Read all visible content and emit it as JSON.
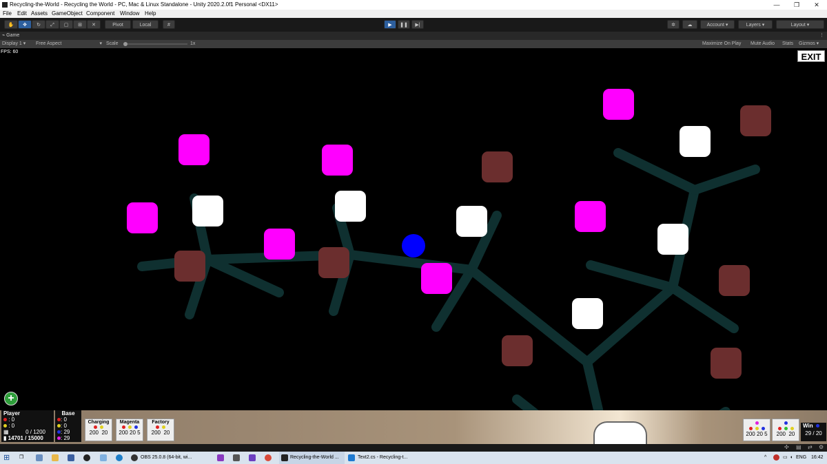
{
  "window": {
    "title": "Recycling-the-World - Recycling the World - PC, Mac & Linux Standalone - Unity 2020.2.0f1 Personal <DX11>",
    "minimize": "—",
    "maximize": "❐",
    "close": "✕"
  },
  "menu": [
    "File",
    "Edit",
    "Assets",
    "GameObject",
    "Component",
    "Window",
    "Help"
  ],
  "toolbar": {
    "pivot": "Pivot",
    "local": "Local",
    "account": "Account",
    "layers": "Layers",
    "layout": "Layout"
  },
  "game_tab": {
    "label": "Game"
  },
  "game_bar": {
    "display": "Display 1",
    "aspect": "Free Aspect",
    "scale_label": "Scale",
    "scale_value": "1x",
    "maximize": "Maximize On Play",
    "mute": "Mute Audio",
    "stats": "Stats",
    "gizmos": "Gizmos"
  },
  "game": {
    "fps": "FPS: 60",
    "exit": "EXIT",
    "colors": {
      "magenta": "#ff00ff",
      "brown": "#6b2e2e",
      "white": "#ffffff",
      "blue": "#0000ff",
      "link": "#0f3333"
    }
  },
  "hud": {
    "player": {
      "label": "Player",
      "red": ": 0",
      "yellow": ": 0",
      "storage": "0 / 1200",
      "energy": "14701 / 15000"
    },
    "base": {
      "label": "Base",
      "red": ": 0",
      "yellow": ": 0",
      "blue": ": 29",
      "magenta": ": 29"
    },
    "charging": {
      "label": "Charging",
      "a": "200",
      "b": "20"
    },
    "magenta": {
      "label": "Magenta",
      "a": "200",
      "b": "20",
      "c": "5"
    },
    "factory": {
      "label": "Factory",
      "a": "200",
      "b": "20"
    },
    "right1": {
      "a": "200",
      "b": "20",
      "c": "5"
    },
    "right2": {
      "a": "200",
      "b": "20"
    },
    "win": {
      "label": "Win",
      "value": "29 / 20"
    }
  },
  "taskbar": {
    "obs": "OBS 25.0.8 (64-bit, wi...",
    "unity": "Recycling-the-World ...",
    "vscode": "Text2.cs - Recycling-t...",
    "lang": "ENG",
    "time": "16:42"
  }
}
